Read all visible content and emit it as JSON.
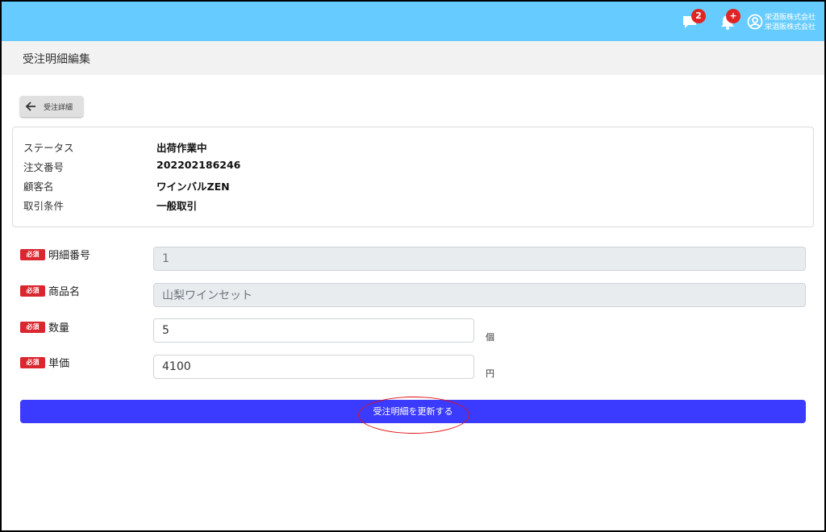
{
  "header": {
    "message_badge": "2",
    "notification_badge": "+",
    "company_line1": "栄酒販株式会社",
    "company_line2": "栄酒販株式会社",
    "bg_color": "#66ccff"
  },
  "page": {
    "title": "受注明細編集"
  },
  "back_button": {
    "label": "受注詳細"
  },
  "info": [
    {
      "label": "ステータス",
      "value": "出荷作業中"
    },
    {
      "label": "注文番号",
      "value": "202202186246"
    },
    {
      "label": "顧客名",
      "value": "ワインバルZEN"
    },
    {
      "label": "取引条件",
      "value": "一般取引"
    }
  ],
  "form": {
    "required_tag": "必須",
    "fields": [
      {
        "label": "明細番号",
        "value": "1",
        "disabled": true,
        "unit": ""
      },
      {
        "label": "商品名",
        "value": "山梨ワインセット",
        "disabled": true,
        "unit": ""
      },
      {
        "label": "数量",
        "value": "5",
        "disabled": false,
        "unit": "個"
      },
      {
        "label": "単価",
        "value": "4100",
        "disabled": false,
        "unit": "円"
      }
    ],
    "submit_label": "受注明細を更新する",
    "submit_color": "#3b3bff",
    "required_color": "#d9262f"
  }
}
